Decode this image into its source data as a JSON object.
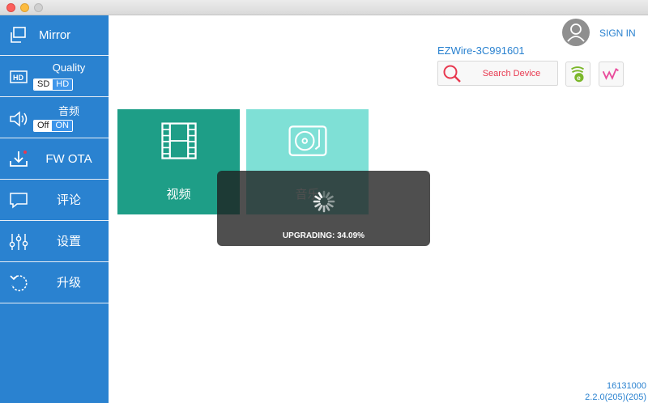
{
  "window": {
    "controls": [
      "close",
      "minimize",
      "zoom"
    ]
  },
  "sidebar": {
    "mirror": {
      "label": "Mirror",
      "icon": "mirror-icon"
    },
    "quality": {
      "title": "Quality",
      "option_sd": "SD",
      "option_hd": "HD",
      "selected": "HD",
      "icon": "hd-icon"
    },
    "audio": {
      "title": "音频",
      "option_off": "Off",
      "option_on": "ON",
      "selected": "ON",
      "icon": "speaker-icon"
    },
    "fw_ota": {
      "label": "FW OTA",
      "icon": "download-icon"
    },
    "comment": {
      "label": "评论",
      "icon": "comment-icon"
    },
    "settings": {
      "label": "设置",
      "icon": "sliders-icon"
    },
    "upgrade": {
      "label": "升级",
      "icon": "refresh-icon"
    }
  },
  "header": {
    "sign_in": "SIGN IN",
    "device_name": "EZWire-3C991601",
    "search_label": "Search Device"
  },
  "tiles": {
    "video": {
      "label": "视频",
      "icon": "film-icon"
    },
    "music": {
      "label": "音乐",
      "icon": "turntable-icon"
    }
  },
  "overlay": {
    "message": "UPGRADING: 34.09%",
    "progress_percent": 34.09
  },
  "footer": {
    "build": "16131000",
    "version": "2.2.0(205)(205)"
  },
  "colors": {
    "sidebar": "#2a82d0",
    "accent": "#2a82d0",
    "video_tile": "#1e9e87",
    "music_tile": "#7fe0d6",
    "search_text": "#e8384f"
  }
}
